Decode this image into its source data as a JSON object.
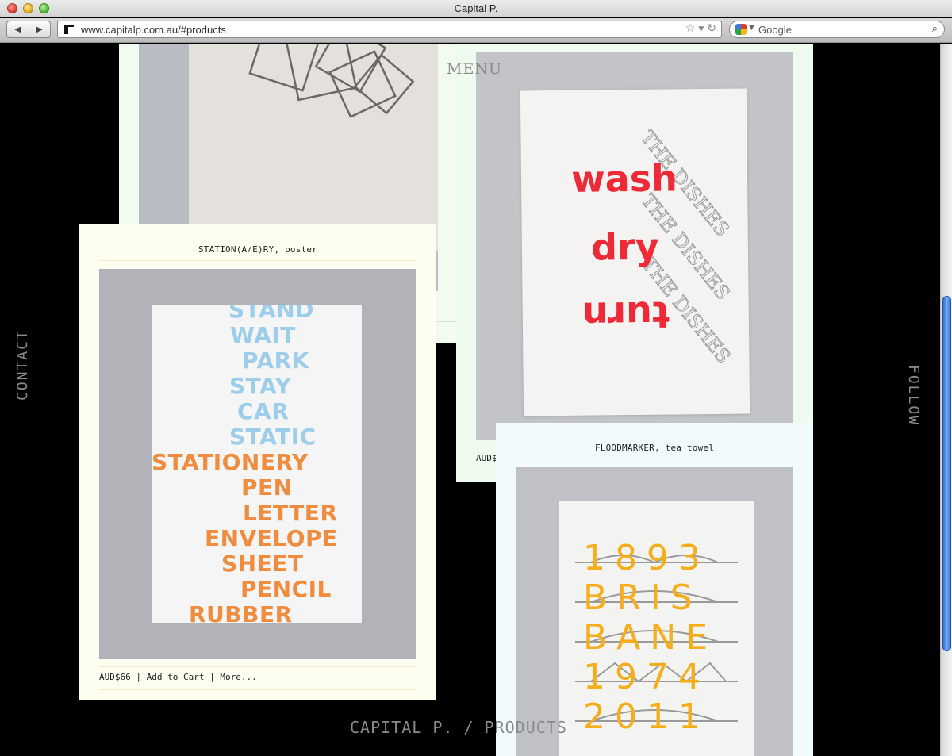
{
  "window": {
    "title": "Capital P."
  },
  "browser": {
    "url": "www.capitalp.com.au/#products",
    "search_placeholder": "Google"
  },
  "nav": {
    "menu": "MENU",
    "contact": "CONTACT",
    "follow": "FOLLOW",
    "breadcrumb": "CAPITAL P. / PRODUCTS"
  },
  "products": [
    {
      "title": "STATION(A/E)RY, poster",
      "price": "AUD$66",
      "add_to_cart": "Add to Cart",
      "more": "More...",
      "separator": "|",
      "poster_words_blue": [
        "STAND",
        "WAIT",
        "PARK",
        "STAY",
        "CAR",
        "STATIC"
      ],
      "poster_words_orange": [
        "STATIONERY",
        "PEN",
        "LETTER",
        "ENVELOPE",
        "SHEET",
        "PENCIL",
        "RUBBER"
      ]
    },
    {
      "title": "FLOODMARKER, tea towel",
      "towel_lines": [
        "1893",
        "BRIS",
        "BANE",
        "1974",
        "2011"
      ]
    },
    {
      "title": "",
      "price_partial": "AUD$",
      "towel_words": [
        "wash",
        "dry",
        "turn"
      ],
      "towel_stamp": "THE DISHES"
    }
  ],
  "colors": {
    "poster_blue": "#9ccdea",
    "poster_orange": "#ef8c3e",
    "wash_red": "#ee2a39",
    "flood_yellow": "#f6ad1a",
    "nav_grey": "#8a8a8a"
  }
}
